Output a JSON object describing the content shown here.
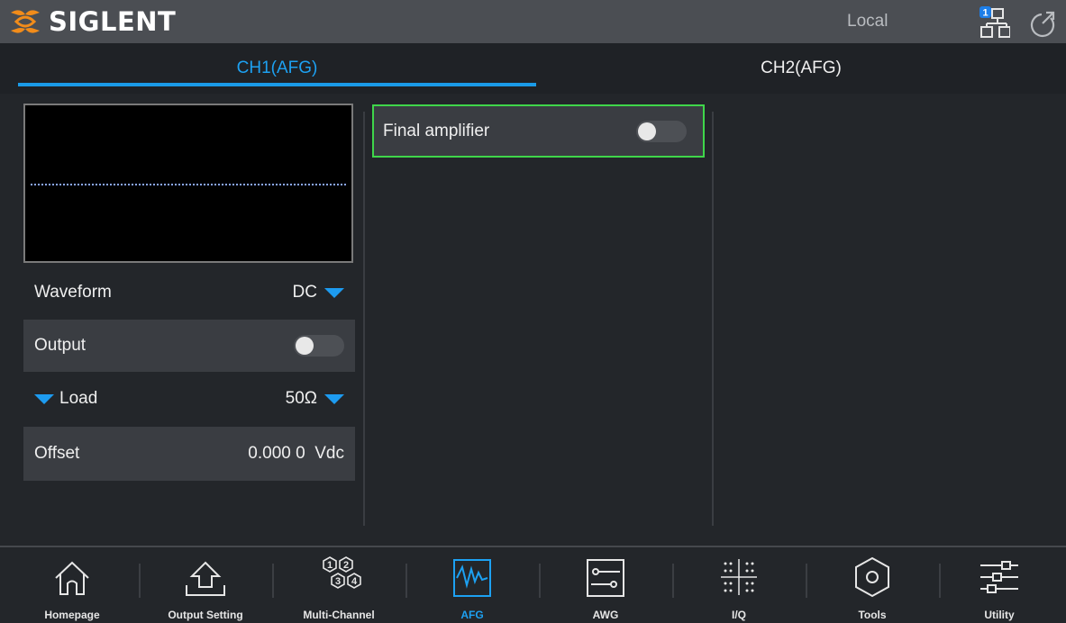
{
  "header": {
    "brand": "SIGLENT",
    "mode": "Local",
    "network_badge": "1"
  },
  "tabs": [
    {
      "label": "CH1(AFG)",
      "active": true
    },
    {
      "label": "CH2(AFG)",
      "active": false
    }
  ],
  "left_panel": {
    "waveform": {
      "label": "Waveform",
      "value": "DC"
    },
    "output": {
      "label": "Output",
      "state": "off"
    },
    "load": {
      "label": "Load",
      "value": "50Ω"
    },
    "offset": {
      "label": "Offset",
      "value": "0.000 0  Vdc"
    }
  },
  "final_amp": {
    "label": "Final amplifier",
    "state": "off"
  },
  "nav": [
    {
      "label": "Homepage",
      "icon": "home-icon"
    },
    {
      "label": "Output Setting",
      "icon": "output-setting-icon"
    },
    {
      "label": "Multi-Channel",
      "icon": "multi-channel-icon"
    },
    {
      "label": "AFG",
      "icon": "afg-icon",
      "active": true
    },
    {
      "label": "AWG",
      "icon": "awg-icon"
    },
    {
      "label": "I/Q",
      "icon": "iq-icon"
    },
    {
      "label": "Tools",
      "icon": "tools-icon"
    },
    {
      "label": "Utility",
      "icon": "utility-icon"
    }
  ],
  "colors": {
    "accent": "#1da1f2",
    "highlight": "#3fd64a",
    "topbar": "#4b4e53",
    "background": "#23262a"
  }
}
